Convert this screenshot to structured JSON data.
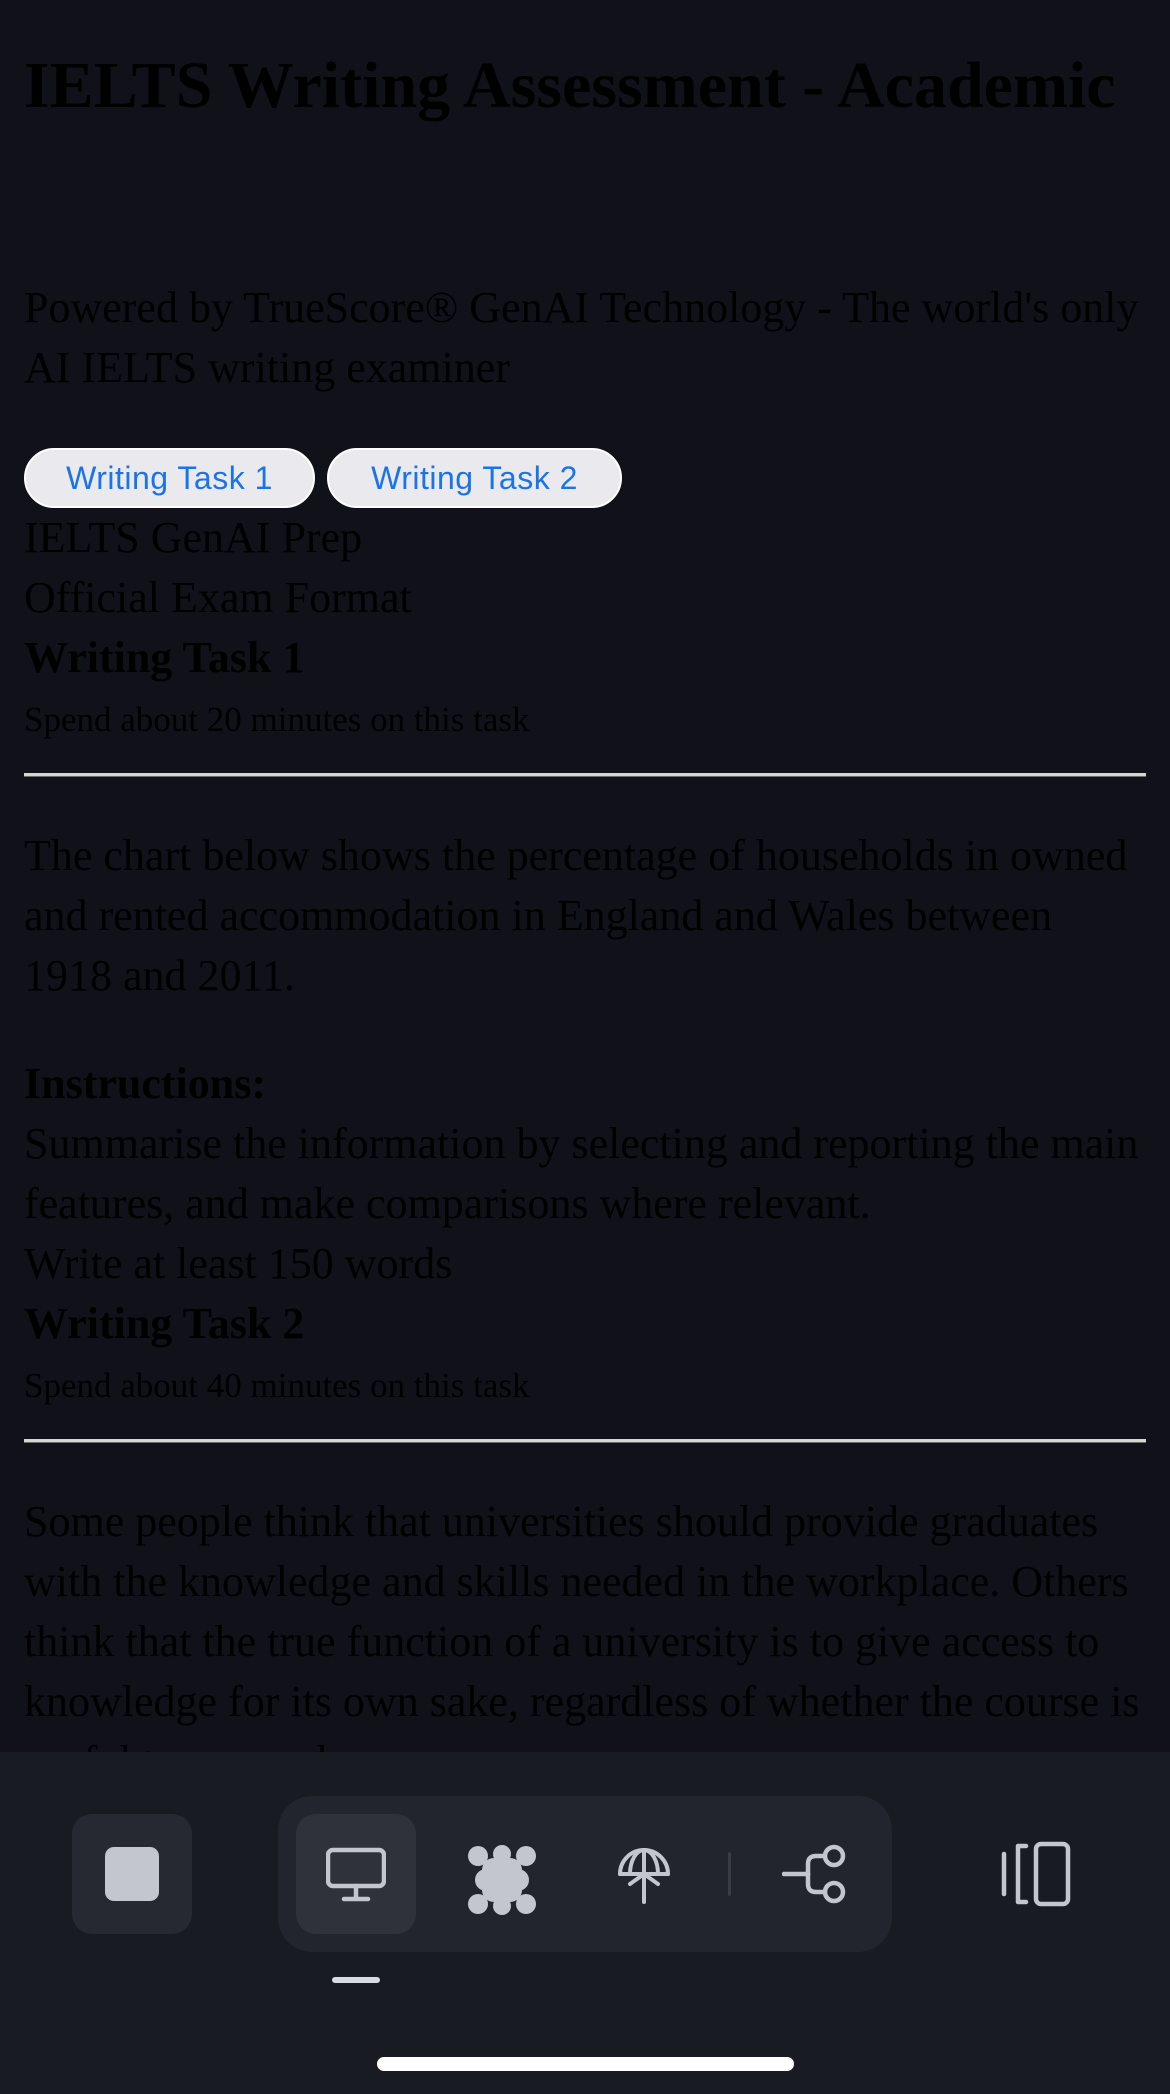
{
  "page": {
    "title": "IELTS Writing Assessment - Academic",
    "subtitle": "Powered by TrueScore® GenAI Technology - The world's only AI IELTS writing examiner"
  },
  "tabs": [
    {
      "label": "Writing Task 1"
    },
    {
      "label": "Writing Task 2"
    }
  ],
  "info": {
    "prep_label": "IELTS GenAI Prep",
    "format_label": "Official Exam Format"
  },
  "task1": {
    "heading": "Writing Task 1",
    "time_note": "Spend about 20 minutes on this task",
    "prompt": "The chart below shows the percentage of households in owned and rented accommodation in England and Wales between 1918 and 2011.",
    "instructions_label": "Instructions:",
    "instructions": "Summarise the information by selecting and reporting the main features, and make comparisons where relevant.",
    "word_limit": "Write at least 150 words"
  },
  "task2": {
    "heading": "Writing Task 2",
    "time_note": "Spend about 40 minutes on this task",
    "prompt": "Some people think that universities should provide graduates with the knowledge and skills needed in the workplace. Others think that the true function of a university is to give access to knowledge for its own sake, regardless of whether the course is useful to an employer."
  },
  "toolbar": {
    "icons": [
      "stop-icon",
      "desktop-icon",
      "apps-grid-icon",
      "antenna-icon",
      "share-flow-icon",
      "side-panel-icon"
    ],
    "active_tab": "desktop"
  },
  "colors": {
    "background": "#111219",
    "toolbar_bg": "#191b22",
    "tab_text": "#1a74e8",
    "tab_bg": "#e9e9ee"
  }
}
